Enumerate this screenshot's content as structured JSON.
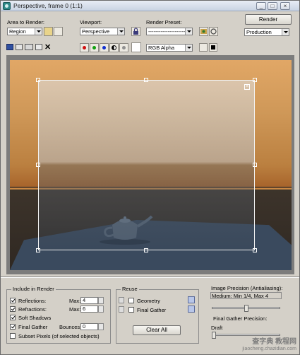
{
  "window": {
    "title": "Perspective, frame 0 (1:1)"
  },
  "toolbar": {
    "area_label": "Area to Render:",
    "area_value": "Region",
    "viewport_label": "Viewport:",
    "viewport_value": "Perspective",
    "preset_label": "Render Preset:",
    "preset_value": "-------------------------",
    "render_label": "Render",
    "production_value": "Production",
    "channel_value": "RGB Alpha"
  },
  "bottom": {
    "include_title": "Include in Render",
    "reflections_label": "Reflections:",
    "reflections_max_label": "Max:",
    "reflections_max": "4",
    "refractions_label": "Refractions:",
    "refractions_max_label": "Max:",
    "refractions_max": "6",
    "soft_shadows_label": "Soft Shadows",
    "final_gather_label": "Final Gather",
    "bounces_label": "Bounces:",
    "bounces_value": "0",
    "subset_label": "Subset Pixels (of selected objects)",
    "reuse_title": "Reuse",
    "geometry_label": "Geometry",
    "reuse_fg_label": "Final Gather",
    "clear_all_label": "Clear All",
    "precision_title": "Image Precision (Antialiasing):",
    "precision_value": "Medium: Min 1/4, Max 4",
    "precision_slider": 0.5,
    "fg_precision_title": "Final Gather Precision:",
    "fg_precision_value": "Draft",
    "fg_progress": 0.0
  },
  "watermark": {
    "line1": "查字典 教程网",
    "line2": "jiaocheng.chazidian.com"
  },
  "colors": {
    "sky_top": "#e1a766",
    "horizon": "#c98844",
    "ground": "#2f2822",
    "table": "#3a4a5e"
  }
}
